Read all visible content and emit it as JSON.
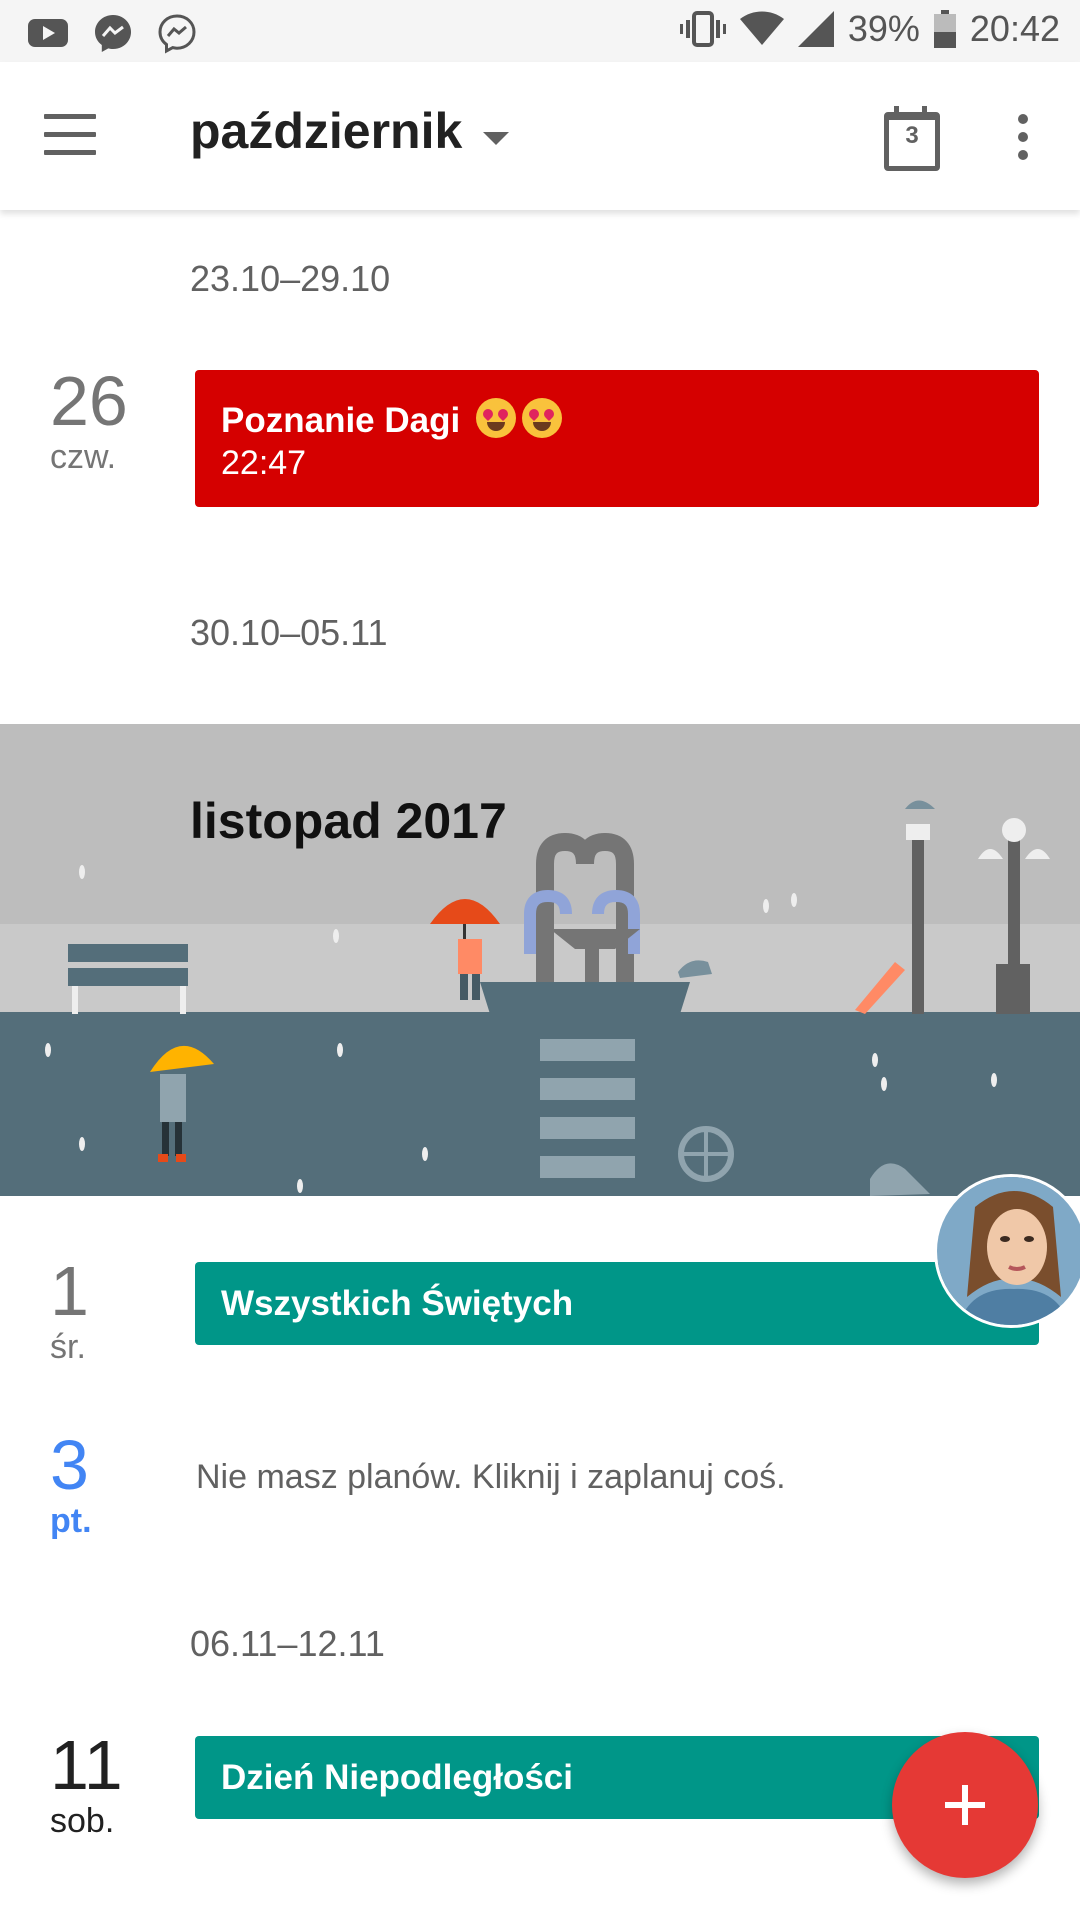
{
  "status_bar": {
    "left_icons": [
      "youtube-icon",
      "messenger-icon",
      "messenger-outline-icon"
    ],
    "right_icons": [
      "vibrate-icon",
      "wifi-icon",
      "signal-icon",
      "battery-icon"
    ],
    "battery": "39%",
    "time": "20:42"
  },
  "app_bar": {
    "title": "październik",
    "today_day": "3",
    "icons": [
      "menu-icon",
      "dropdown-caret-icon",
      "calendar-today-icon",
      "more-vert-icon"
    ]
  },
  "weeks": [
    {
      "range": "23.10–29.10"
    },
    {
      "range": "30.10–05.11"
    },
    {
      "range": "06.11–12.11"
    }
  ],
  "days": [
    {
      "num": "26",
      "name": "czw.",
      "event": {
        "title": "Poznanie Dagi",
        "time": "22:47",
        "color": "#d50000"
      }
    },
    {
      "num": "1",
      "name": "śr.",
      "event": {
        "title": "Wszystkich Świętych",
        "color": "#009688"
      }
    },
    {
      "num": "3",
      "name": "pt.",
      "today": true,
      "today_color": "#4285f4",
      "no_plans": "Nie masz planów. Kliknij i zaplanuj coś."
    },
    {
      "num": "11",
      "name": "sob.",
      "event": {
        "title": "Dzień Niepodległości",
        "color": "#009688"
      }
    }
  ],
  "month_banner": {
    "title": "listopad 2017"
  },
  "fab": {
    "icon": "plus-icon",
    "color": "#e53935"
  }
}
